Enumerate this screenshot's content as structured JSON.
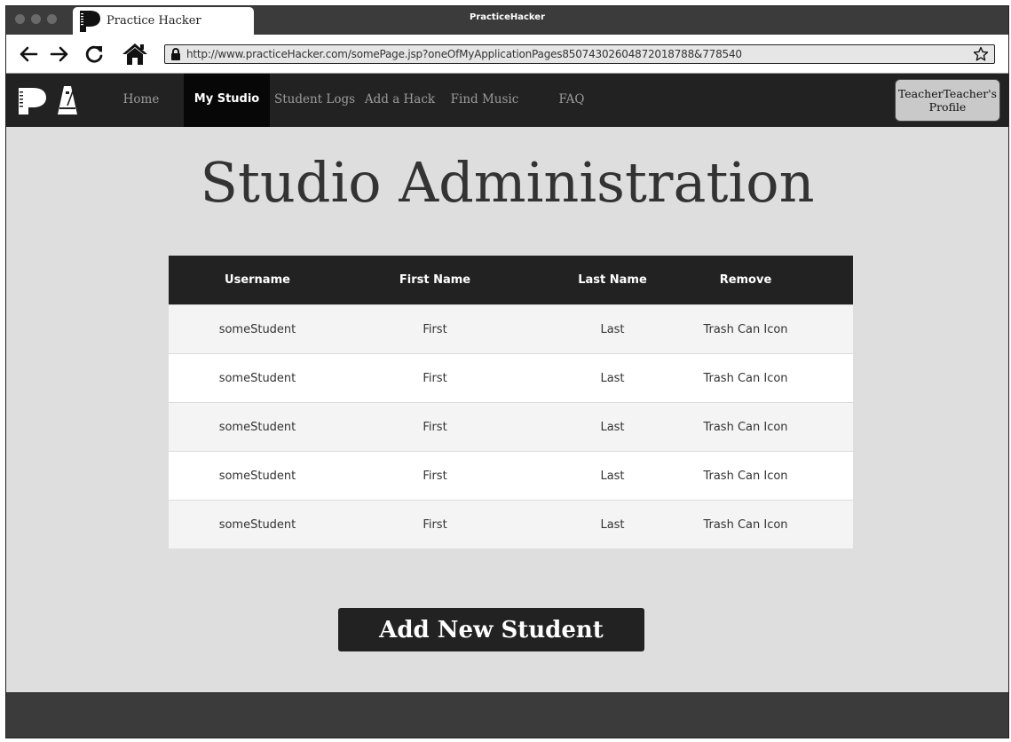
{
  "browser": {
    "tab_title": "Practice Hacker",
    "window_title": "PracticeHacker",
    "url": "http://www.practiceHacker.com/somePage.jsp?oneOfMyApplicationPages85074302604872018788&778540"
  },
  "nav": {
    "items": [
      {
        "label": "Home",
        "active": false
      },
      {
        "label": "My Studio",
        "active": true
      },
      {
        "label": "Student Logs",
        "active": false
      },
      {
        "label": "Add a Hack",
        "active": false
      },
      {
        "label": "Find Music",
        "active": false
      },
      {
        "label": "FAQ",
        "active": false
      }
    ],
    "profile_label": "TeacherTeacher's Profile"
  },
  "main": {
    "title": "Studio Administration",
    "table": {
      "headers": [
        "Username",
        "First Name",
        "Last Name",
        "Remove"
      ],
      "rows": [
        [
          "someStudent",
          "First",
          "Last",
          "Trash Can Icon"
        ],
        [
          "someStudent",
          "First",
          "Last",
          "Trash Can Icon"
        ],
        [
          "someStudent",
          "First",
          "Last",
          "Trash Can Icon"
        ],
        [
          "someStudent",
          "First",
          "Last",
          "Trash Can Icon"
        ],
        [
          "someStudent",
          "First",
          "Last",
          "Trash Can Icon"
        ]
      ]
    },
    "add_button_label": "Add New Student"
  },
  "colors": {
    "nav_bg": "#222222",
    "nav_active_bg": "#070707",
    "page_bg": "#dedede",
    "button_bg": "#222222"
  }
}
